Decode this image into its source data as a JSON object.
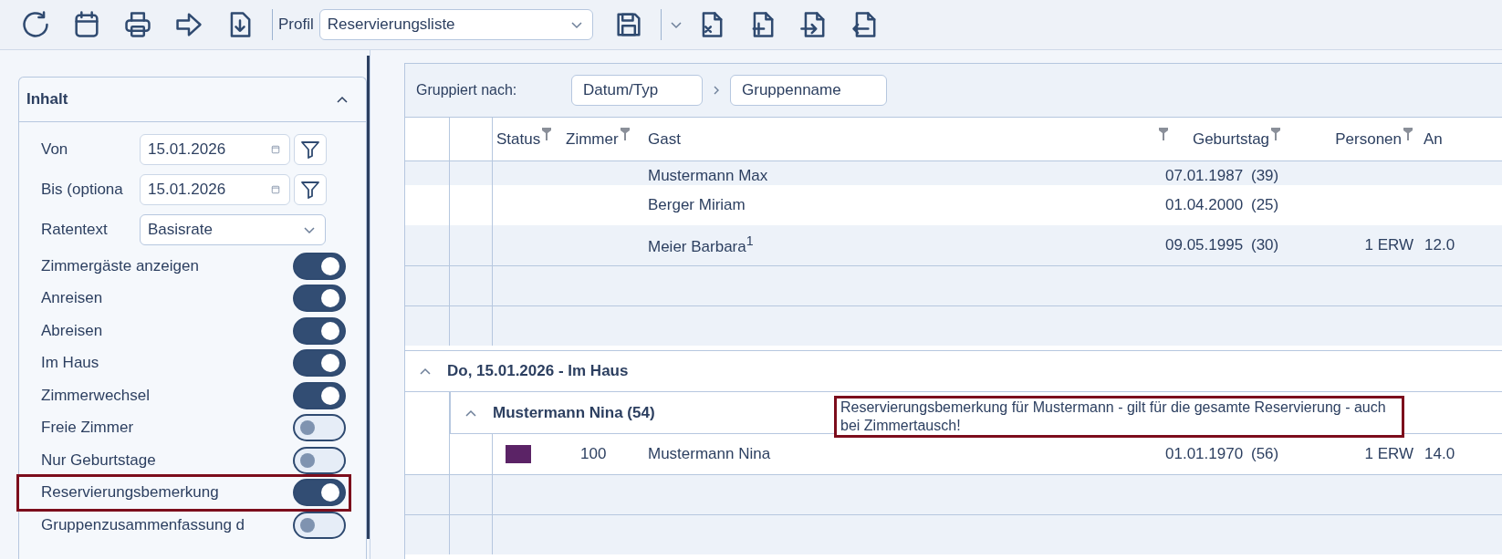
{
  "toolbar": {
    "profile_label": "Profil",
    "profile_value": "Reservierungsliste"
  },
  "panel": {
    "title": "Inhalt",
    "expanded": true,
    "fields": [
      {
        "kind": "date",
        "label": "Von",
        "value": "15.01.2026"
      },
      {
        "kind": "date",
        "label": "Bis (optiona",
        "value": "15.01.2026"
      },
      {
        "kind": "select",
        "label": "Ratentext",
        "value": "Basisrate"
      }
    ],
    "toggles": [
      {
        "label": "Zimmergäste anzeigen",
        "on": true,
        "highlighted": false
      },
      {
        "label": "Anreisen",
        "on": true,
        "highlighted": false
      },
      {
        "label": "Abreisen",
        "on": true,
        "highlighted": false
      },
      {
        "label": "Im Haus",
        "on": true,
        "highlighted": false
      },
      {
        "label": "Zimmerwechsel",
        "on": true,
        "highlighted": false
      },
      {
        "label": "Freie Zimmer",
        "on": false,
        "highlighted": false
      },
      {
        "label": "Nur Geburtstage",
        "on": false,
        "highlighted": false
      },
      {
        "label": "Reservierungsbemerkung",
        "on": true,
        "highlighted": true
      },
      {
        "label": "Gruppenzusammenfassung d",
        "on": false,
        "highlighted": false
      }
    ]
  },
  "grid": {
    "group_label": "Gruppiert nach:",
    "group_chips": [
      "Datum/Typ",
      "Gruppenname"
    ],
    "columns": [
      {
        "label": "Status",
        "filter": true
      },
      {
        "label": "Zimmer",
        "filter": true
      },
      {
        "label": "Gast",
        "filter": true
      },
      {
        "label": "Geburtstag",
        "filter": true
      },
      {
        "label": "Personen",
        "filter": true
      },
      {
        "label": "An",
        "filter": false
      }
    ],
    "rows": [
      {
        "kind": "guest",
        "room": "",
        "guest": "Mustermann Max",
        "birthday": "07.01.1987",
        "age": "(39)",
        "persons": "",
        "column_6": ""
      },
      {
        "kind": "guest",
        "room": "",
        "guest": "Berger Miriam",
        "birthday": "01.04.2000",
        "age": "(25)",
        "persons": "",
        "column_6": ""
      },
      {
        "kind": "guest",
        "room": "",
        "guest": "Meier Barbara$^{1}$",
        "birthday": "09.05.1995",
        "age": "(30)",
        "persons": "1 ERW",
        "column_6": "12.0"
      },
      {
        "kind": "empty"
      },
      {
        "kind": "empty"
      },
      {
        "kind": "group",
        "label": "Do, 15.01.2026 - Im Haus",
        "expanded": true
      },
      {
        "kind": "subgroup",
        "label": "Mustermann Nina (54)",
        "expanded": true,
        "remark": "Reservierungsbemerkung für Mustermann - gilt für die gesamte Reservierung - auch bei Zimmertausch!"
      },
      {
        "kind": "guest",
        "color": "#5b2366",
        "room": "100",
        "guest": "Mustermann Nina",
        "birthday": "01.01.1970",
        "age": "(56)",
        "persons": "1 ERW",
        "column_6": "14.0"
      },
      {
        "kind": "empty"
      },
      {
        "kind": "empty"
      }
    ]
  }
}
